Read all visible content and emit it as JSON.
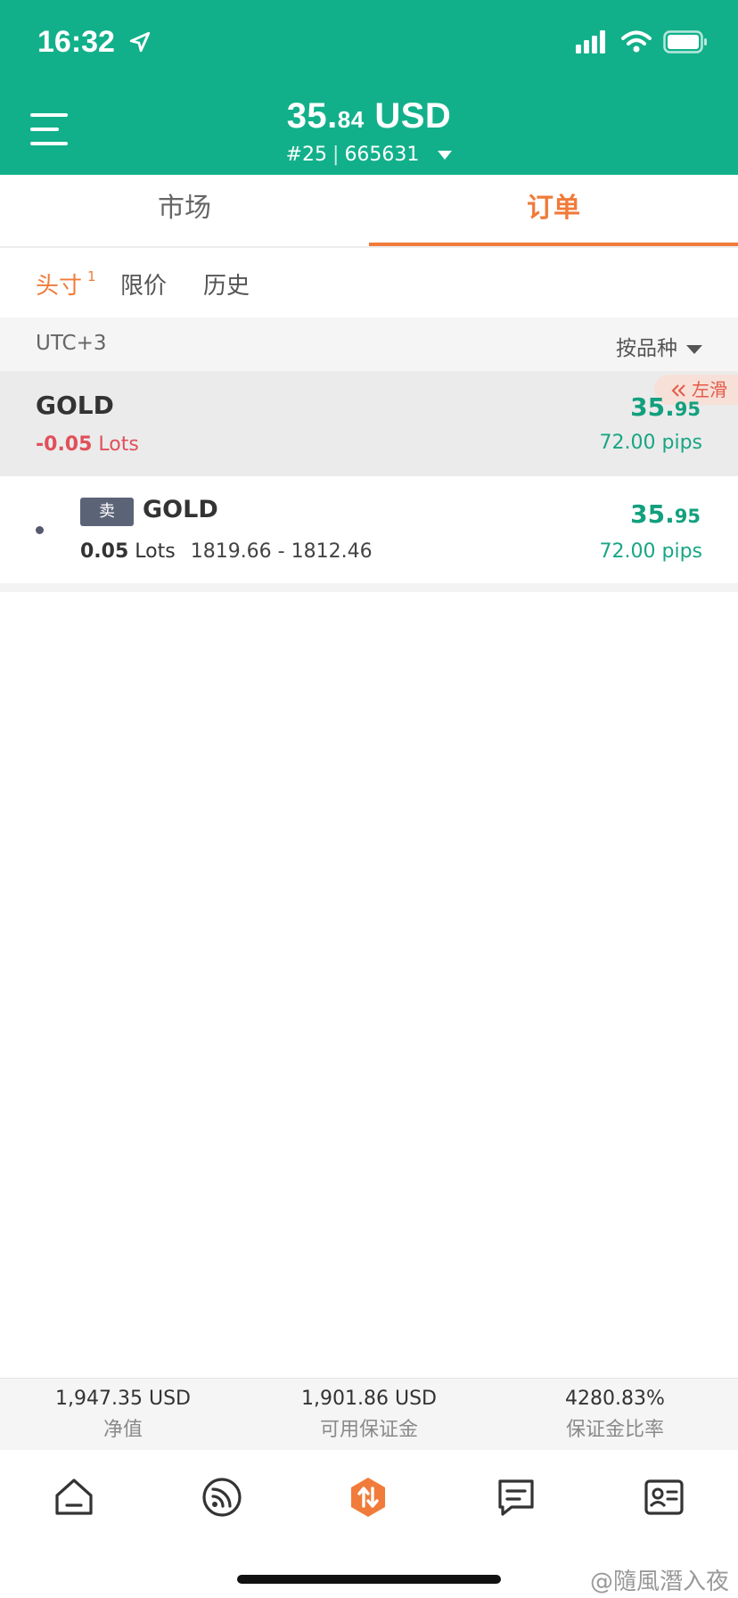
{
  "status_bar": {
    "time": "16:32"
  },
  "header": {
    "balance_main": "35.",
    "balance_small": "84",
    "balance_currency": "USD",
    "account_number": "#25",
    "account_id": "665631"
  },
  "tabs": [
    {
      "label": "市场",
      "active": false
    },
    {
      "label": "订单",
      "active": true
    }
  ],
  "subtabs": [
    {
      "label": "头寸",
      "badge": "1",
      "active": true
    },
    {
      "label": "限价",
      "active": false
    },
    {
      "label": "历史",
      "active": false
    }
  ],
  "filter": {
    "timezone": "UTC+3",
    "sort_label": "按品种"
  },
  "group": {
    "symbol": "GOLD",
    "lots_value": "-0.05",
    "lots_unit": "Lots",
    "profit_main": "35.",
    "profit_small": "95",
    "pips": "72.00 pips",
    "swipe_hint": "左滑"
  },
  "position": {
    "side": "卖",
    "symbol": "GOLD",
    "lots_value": "0.05",
    "lots_unit": "Lots",
    "prices": "1819.66 - 1812.46",
    "profit_main": "35.",
    "profit_small": "95",
    "pips": "72.00 pips"
  },
  "summary": [
    {
      "value": "1,947.35 USD",
      "label": "净值"
    },
    {
      "value": "1,901.86 USD",
      "label": "可用保证金"
    },
    {
      "value": "4280.83%",
      "label": "保证金比率"
    }
  ],
  "bottom_nav": [
    {
      "icon": "home-icon",
      "active": false
    },
    {
      "icon": "feed-icon",
      "active": false
    },
    {
      "icon": "trade-icon",
      "active": true
    },
    {
      "icon": "messages-icon",
      "active": false
    },
    {
      "icon": "profile-card-icon",
      "active": false
    }
  ],
  "colors": {
    "brand_green": "#12b08a",
    "accent_orange": "#f07b3a",
    "loss_red": "#e0505a",
    "profit_green": "#12a07e"
  },
  "watermark": "@隨風潛入夜"
}
